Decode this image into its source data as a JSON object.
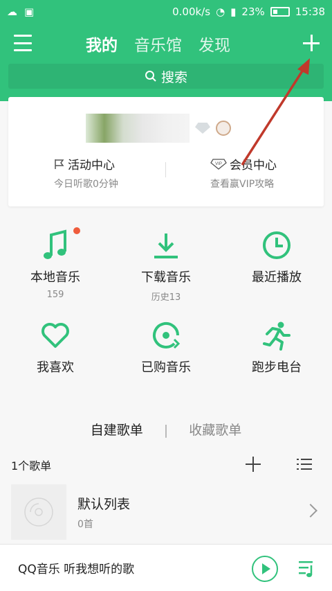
{
  "status_bar": {
    "speed": "0.00k/s",
    "battery": "23%",
    "time": "15:38"
  },
  "top_tabs": [
    {
      "label": "我的"
    },
    {
      "label": "音乐馆"
    },
    {
      "label": "发现"
    }
  ],
  "search": {
    "label": "搜索"
  },
  "profile_card": {
    "activity_title": "活动中心",
    "activity_sub": "今日听歌0分钟",
    "vip_title": "会员中心",
    "vip_sub": "查看赢VIP攻略",
    "vip_badge_text": "VIP"
  },
  "grid": [
    {
      "label": "本地音乐",
      "count": "159"
    },
    {
      "label": "下载音乐",
      "count": "历史13"
    },
    {
      "label": "最近播放",
      "count": ""
    },
    {
      "label": "我喜欢",
      "count": ""
    },
    {
      "label": "已购音乐",
      "count": ""
    },
    {
      "label": "跑步电台",
      "count": ""
    }
  ],
  "playlist_tabs": {
    "created": "自建歌单",
    "separator": "|",
    "favorites": "收藏歌单"
  },
  "playlist_header": {
    "count": "1个歌单"
  },
  "playlist_item": {
    "name": "默认列表",
    "songs": "0首"
  },
  "bottom_bar": {
    "slogan": "QQ音乐 听我想听的歌"
  },
  "colors": {
    "brand_green": "#31c27c",
    "annotation_arrow": "#c0392b",
    "notification_dot": "#ef5c3c"
  }
}
